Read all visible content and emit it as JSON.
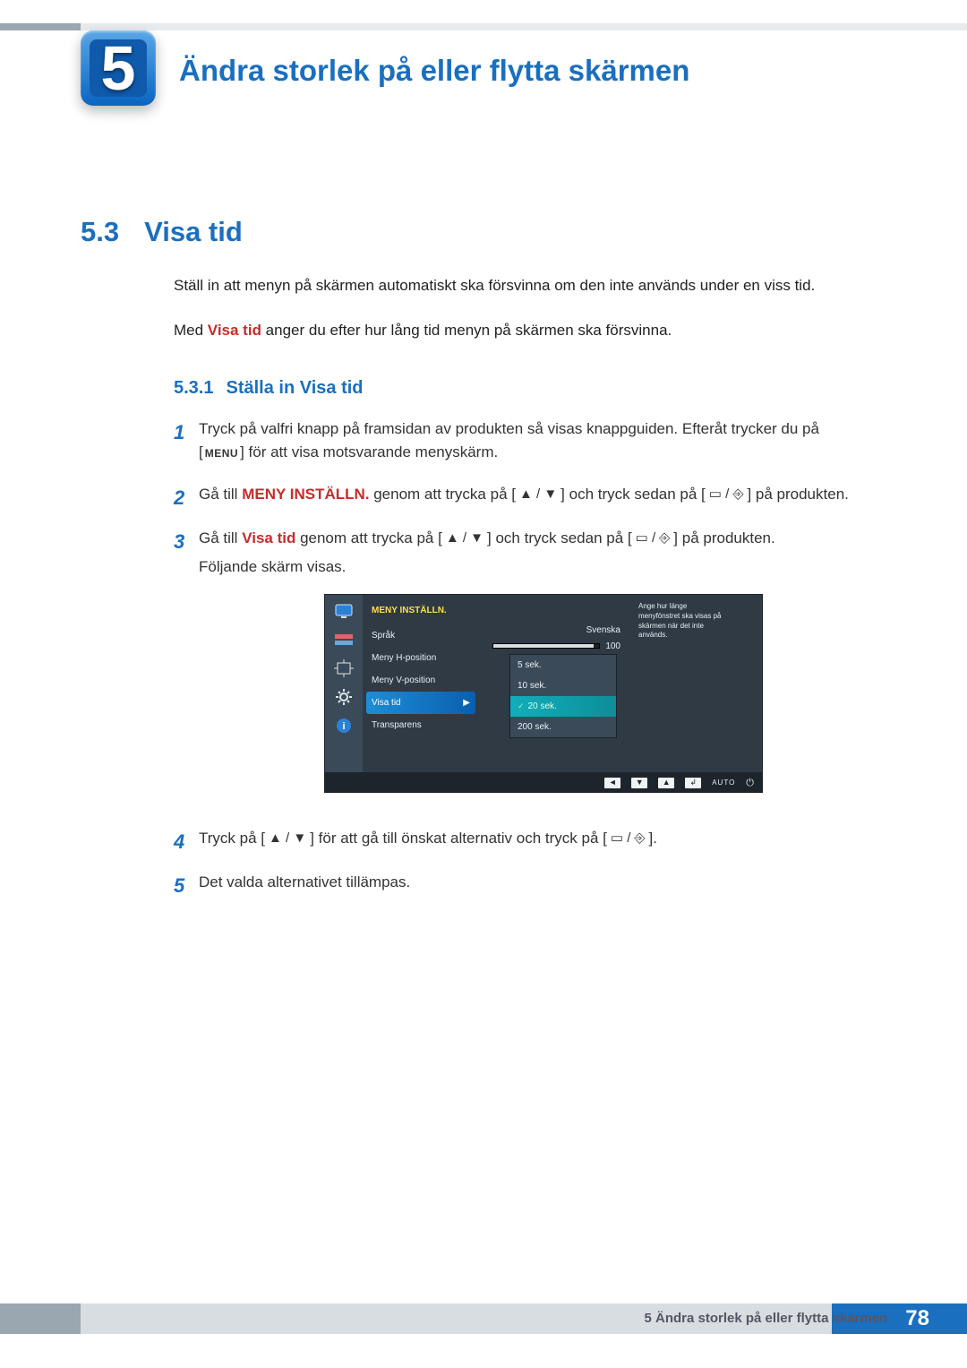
{
  "chapter": {
    "number": "5",
    "title": "Ändra storlek på eller flytta skärmen"
  },
  "section": {
    "number": "5.3",
    "title": "Visa tid",
    "intro1": "Ställ in att menyn på skärmen automatiskt ska försvinna om den inte används under en viss tid.",
    "intro2a": "Med ",
    "intro2_kw": "Visa tid",
    "intro2b": " anger du efter hur lång tid menyn på skärmen ska försvinna."
  },
  "subsection": {
    "number": "5.3.1",
    "title": "Ställa in Visa tid"
  },
  "steps": {
    "s1a": "Tryck på valfri knapp på framsidan av produkten så visas knappguiden. Efteråt trycker du på [",
    "s1_menu": "MENU",
    "s1b": "] för att visa motsvarande menyskärm.",
    "s2a": "Gå till ",
    "s2_kw": "MENY INSTÄLLN.",
    "s2b": " genom att trycka på [",
    "s2c": "] och tryck sedan på [",
    "s2d": "] på produkten.",
    "s3a": "Gå till ",
    "s3_kw": "Visa tid",
    "s3b": " genom att trycka på [",
    "s3c": "] och tryck sedan på [",
    "s3d": "] på produkten.",
    "s3e": "Följande skärm visas.",
    "s4a": "Tryck på [",
    "s4b": "] för att gå till önskat alternativ och tryck på [",
    "s4c": "].",
    "s5": "Det valda alternativet tillämpas."
  },
  "osd": {
    "title": "MENY INSTÄLLN.",
    "items": {
      "sprak": {
        "label": "Språk",
        "value": "Svenska"
      },
      "hpos": {
        "label": "Meny H-position",
        "value": "100"
      },
      "vpos": {
        "label": "Meny V-position"
      },
      "visa": {
        "label": "Visa tid"
      },
      "trans": {
        "label": "Transparens"
      }
    },
    "options": [
      "5 sek.",
      "10 sek.",
      "20 sek.",
      "200 sek."
    ],
    "help": "Ange hur länge menyfönstret ska visas på skärmen när det inte används.",
    "auto": "AUTO"
  },
  "footer": {
    "text": "5 Ändra storlek på eller flytta skärmen",
    "page": "78"
  }
}
